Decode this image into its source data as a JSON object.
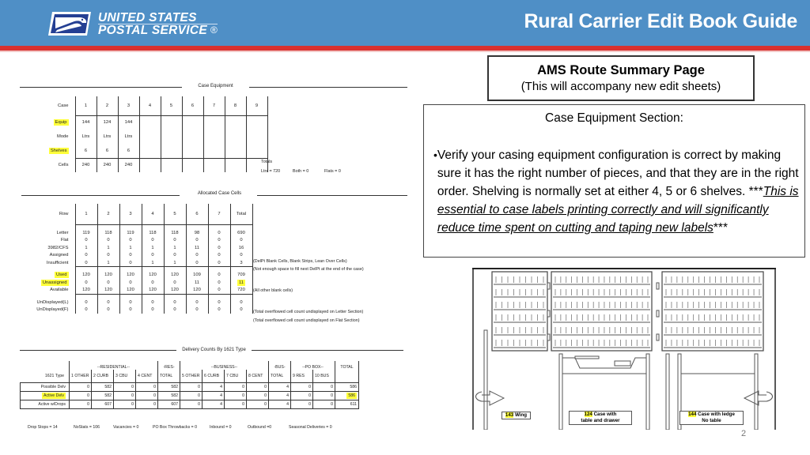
{
  "header": {
    "logo_line1": "UNITED STATES",
    "logo_line2": "POSTAL SERVICE",
    "logo_reg": "®",
    "title": "Rural Carrier Edit Book Guide",
    "brand_blue": "#4f8fc6",
    "brand_red": "#d9312f",
    "logo_icon": "usps-eagle-icon"
  },
  "case_equipment": {
    "section_title": "Case Equipment",
    "header_label": "Case",
    "cases": [
      "1",
      "2",
      "3",
      "4",
      "5",
      "6",
      "7",
      "8",
      "9"
    ],
    "rows": [
      {
        "label": "Equip",
        "highlight": true,
        "values": [
          "144",
          "124",
          "144",
          "",
          "",
          "",
          "",
          "",
          ""
        ]
      },
      {
        "label": "Mode",
        "highlight": false,
        "values": [
          "Ltrs",
          "Ltrs",
          "Ltrs",
          "",
          "",
          "",
          "",
          "",
          ""
        ]
      },
      {
        "label": "Shelves",
        "highlight": true,
        "values": [
          "6",
          "6",
          "6",
          "",
          "",
          "",
          "",
          "",
          ""
        ]
      },
      {
        "label": "Cells",
        "highlight": false,
        "values": [
          "240",
          "240",
          "240",
          "",
          "",
          "",
          "",
          "",
          ""
        ]
      }
    ],
    "totals_label": "Totals",
    "totals": [
      "Ltrs = 720",
      "Both = 0",
      "Flats = 0"
    ]
  },
  "allocated": {
    "section_title": "Allocated Case Cells",
    "header_label": "Row",
    "columns": [
      "1",
      "2",
      "3",
      "4",
      "5",
      "6",
      "7",
      "Total"
    ],
    "groups": [
      [
        {
          "label": "Letter",
          "values": [
            "119",
            "118",
            "119",
            "118",
            "118",
            "98",
            "0",
            "690"
          ]
        },
        {
          "label": "Flat",
          "values": [
            "0",
            "0",
            "0",
            "0",
            "0",
            "0",
            "0",
            "0"
          ]
        },
        {
          "label": "3982/CFS",
          "values": [
            "1",
            "1",
            "1",
            "1",
            "1",
            "11",
            "0",
            "16"
          ]
        },
        {
          "label": "Assigned",
          "values": [
            "0",
            "0",
            "0",
            "0",
            "0",
            "0",
            "0",
            "0"
          ],
          "note": "(DelPt Blank Cells, Blank Strips, Lean Over Cells)"
        },
        {
          "label": "Insufficient",
          "values": [
            "0",
            "1",
            "0",
            "1",
            "1",
            "0",
            "0",
            "3"
          ],
          "note": "(Not enough space to fill next DelPt at the end of the case)"
        }
      ],
      [
        {
          "label": "Used",
          "highlight": true,
          "values": [
            "120",
            "120",
            "120",
            "120",
            "120",
            "109",
            "0",
            "709"
          ]
        },
        {
          "label": "Unassigned",
          "highlight": true,
          "highlight_total": true,
          "values": [
            "0",
            "0",
            "0",
            "0",
            "0",
            "11",
            "0",
            "11"
          ],
          "note": "(All other blank cells)"
        },
        {
          "label": "Available",
          "values": [
            "120",
            "120",
            "120",
            "120",
            "120",
            "120",
            "0",
            "720"
          ]
        }
      ],
      [
        {
          "label": "UnDisplayed(L)",
          "values": [
            "0",
            "0",
            "0",
            "0",
            "0",
            "0",
            "0",
            "0"
          ],
          "note": "(Total overflowed cell count undisplayed on Letter Section)"
        },
        {
          "label": "UnDisplayed(F)",
          "values": [
            "0",
            "0",
            "0",
            "0",
            "0",
            "0",
            "0",
            "0"
          ],
          "note": "(Total overflowed cell count undisplayed on Flat Section)"
        }
      ]
    ]
  },
  "delivery": {
    "section_title": "Delivery Counts By 1621 Type",
    "group_headers": [
      "--RESIDENTIAL--",
      "-RES-",
      "--BUSINESS--",
      "-BUS-",
      "--PO BOX--",
      "TOTAL"
    ],
    "type_label": "1621 Type",
    "columns": [
      "1  OTHER",
      "2  CURB",
      "3  CBU",
      "4  CENT",
      "TOTAL",
      "5  OTHER",
      "6  CURB",
      "7  CBU",
      "8  CENT",
      "TOTAL",
      "9  RES",
      "10  BUS",
      ""
    ],
    "rows": [
      {
        "label": "Possible Delv",
        "values": [
          "0",
          "582",
          "0",
          "0",
          "582",
          "0",
          "4",
          "0",
          "0",
          "4",
          "0",
          "0",
          "586"
        ]
      },
      {
        "label": "Active Delv",
        "highlight": true,
        "highlight_total": true,
        "values": [
          "0",
          "582",
          "0",
          "0",
          "582",
          "0",
          "4",
          "0",
          "0",
          "4",
          "0",
          "0",
          "586"
        ]
      },
      {
        "label": "Active w/Drops",
        "values": [
          "0",
          "607",
          "0",
          "0",
          "607",
          "0",
          "4",
          "0",
          "0",
          "4",
          "0",
          "0",
          "611"
        ]
      }
    ],
    "footer": [
      "Drop Stops = 14",
      "NoStats = 106",
      "Vacancies = 0",
      "PO Box Throwbacks = 0",
      "Inbound = 0",
      "Outbound =0",
      "Seasonal Deliveries = 0"
    ]
  },
  "ams_box": {
    "title": "AMS Route Summary Page",
    "subtitle": "(This will accompany new edit sheets)"
  },
  "case_section": {
    "title": "Case Equipment Section:",
    "bullet": "•",
    "text_plain": "Verify your casing equipment configuration is correct by making sure it has the right number of pieces, and that they are in the right order.  Shelving is normally set at either 4, 5 or 6 shelves.  ***",
    "text_emphasis": "This is essential to case labels printing correctly and will significantly reduce time spent on cutting and taping new labels",
    "text_end": "***"
  },
  "illustration": {
    "captions": [
      {
        "num": "143",
        "text": "Wing",
        "line2": ""
      },
      {
        "num": "124",
        "text": "Case with",
        "line2": "table and drawer"
      },
      {
        "num": "144",
        "text": "Case with ledge",
        "line2": "No table"
      }
    ]
  },
  "page_number": "2"
}
